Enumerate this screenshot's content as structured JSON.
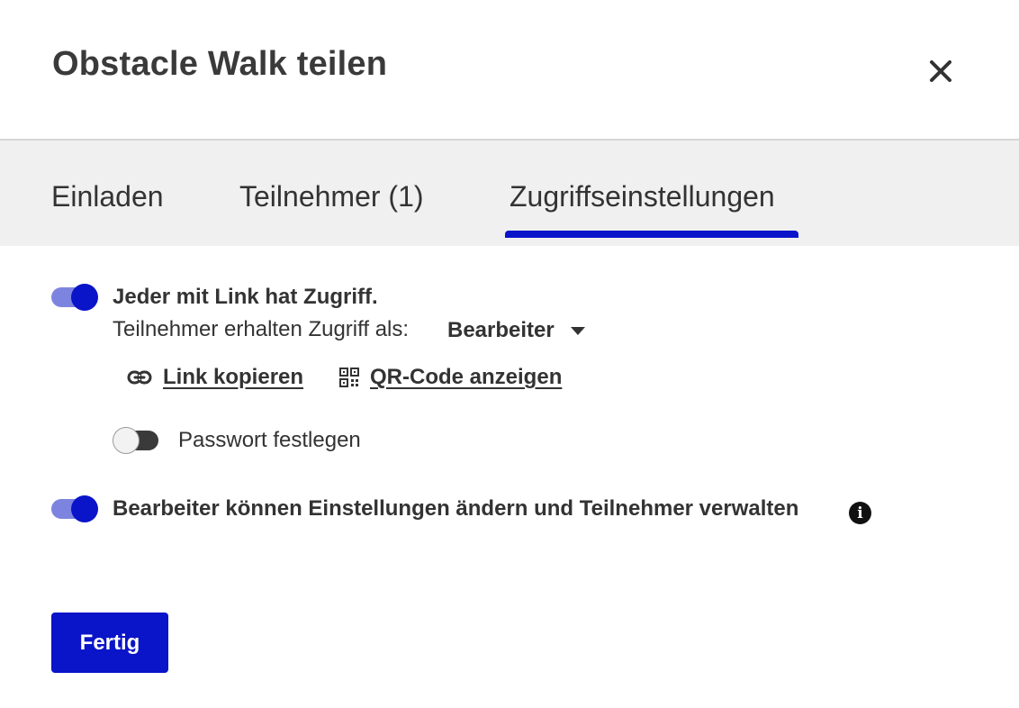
{
  "dialog": {
    "title": "Obstacle Walk teilen",
    "close_icon": "close-icon"
  },
  "tabs": [
    {
      "label": "Einladen",
      "active": false
    },
    {
      "label": "Teilnehmer (1)",
      "active": false
    },
    {
      "label": "Zugriffseinstellungen",
      "active": true
    }
  ],
  "access": {
    "link_access_label": "Jeder mit Link hat Zugriff.",
    "link_access_enabled": true,
    "role_prefix": "Teilnehmer erhalten Zugriff als:",
    "role_value": "Bearbeiter",
    "copy_link_label": "Link kopieren",
    "copy_link_icon": "link-icon",
    "qr_label": "QR-Code anzeigen",
    "qr_icon": "qr-code-icon",
    "password_label": "Passwort festlegen",
    "password_enabled": false,
    "editors_label": "Bearbeiter können Einstellungen ändern und Teilnehmer verwalten",
    "editors_enabled": true,
    "info_icon": "info-icon"
  },
  "footer": {
    "done_label": "Fertig"
  },
  "colors": {
    "accent": "#0a14c8",
    "toggle_track_on": "#7d84e0",
    "tabbar_bg": "#f0f0f0",
    "text": "#333333"
  }
}
